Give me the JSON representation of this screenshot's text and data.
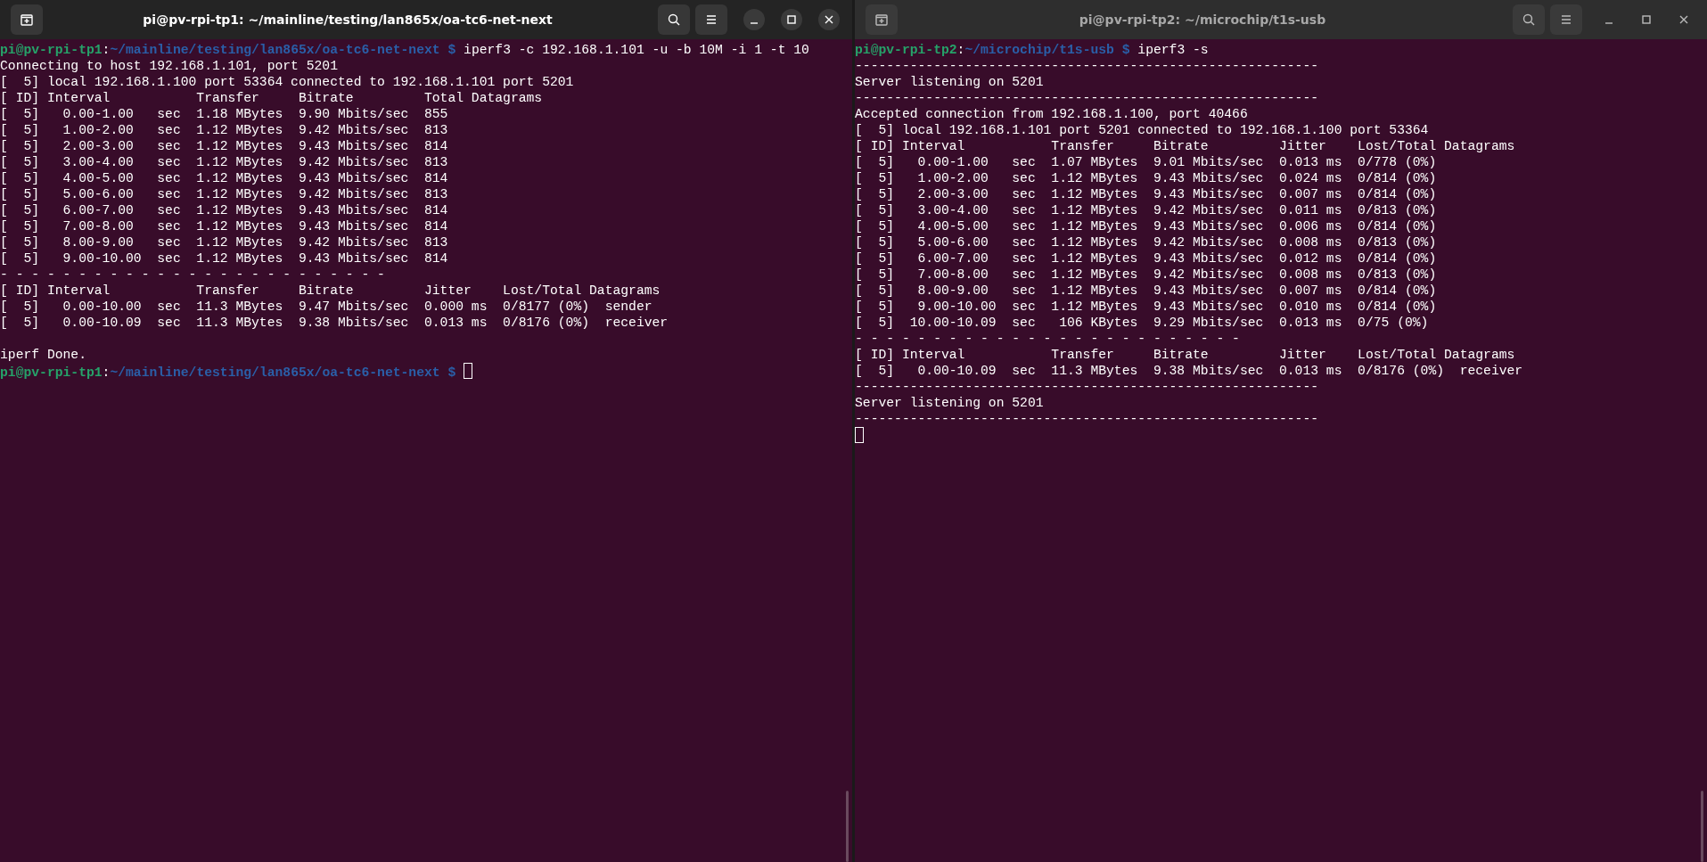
{
  "windows": [
    {
      "title": "pi@pv-rpi-tp1: ~/mainline/testing/lan865x/oa-tc6-net-next",
      "active": true,
      "lines": [
        {
          "kind": "prompt",
          "user_host": "pi@pv-rpi-tp1",
          "separator": ":",
          "path": "~/mainline/testing/lan865x/oa-tc6-net-next $",
          "command": "iperf3 -c 192.168.1.101 -u -b 10M -i 1 -t 10",
          "cursor": false
        },
        {
          "kind": "output",
          "text": "Connecting to host 192.168.1.101, port 5201"
        },
        {
          "kind": "output",
          "text": "[  5] local 192.168.1.100 port 53364 connected to 192.168.1.101 port 5201"
        },
        {
          "kind": "output",
          "text": "[ ID] Interval           Transfer     Bitrate         Total Datagrams"
        },
        {
          "kind": "output",
          "text": "[  5]   0.00-1.00   sec  1.18 MBytes  9.90 Mbits/sec  855"
        },
        {
          "kind": "output",
          "text": "[  5]   1.00-2.00   sec  1.12 MBytes  9.42 Mbits/sec  813"
        },
        {
          "kind": "output",
          "text": "[  5]   2.00-3.00   sec  1.12 MBytes  9.43 Mbits/sec  814"
        },
        {
          "kind": "output",
          "text": "[  5]   3.00-4.00   sec  1.12 MBytes  9.42 Mbits/sec  813"
        },
        {
          "kind": "output",
          "text": "[  5]   4.00-5.00   sec  1.12 MBytes  9.43 Mbits/sec  814"
        },
        {
          "kind": "output",
          "text": "[  5]   5.00-6.00   sec  1.12 MBytes  9.42 Mbits/sec  813"
        },
        {
          "kind": "output",
          "text": "[  5]   6.00-7.00   sec  1.12 MBytes  9.43 Mbits/sec  814"
        },
        {
          "kind": "output",
          "text": "[  5]   7.00-8.00   sec  1.12 MBytes  9.43 Mbits/sec  814"
        },
        {
          "kind": "output",
          "text": "[  5]   8.00-9.00   sec  1.12 MBytes  9.42 Mbits/sec  813"
        },
        {
          "kind": "output",
          "text": "[  5]   9.00-10.00  sec  1.12 MBytes  9.43 Mbits/sec  814"
        },
        {
          "kind": "output",
          "text": "- - - - - - - - - - - - - - - - - - - - - - - - -"
        },
        {
          "kind": "output",
          "text": "[ ID] Interval           Transfer     Bitrate         Jitter    Lost/Total Datagrams"
        },
        {
          "kind": "output",
          "text": "[  5]   0.00-10.00  sec  11.3 MBytes  9.47 Mbits/sec  0.000 ms  0/8177 (0%)  sender"
        },
        {
          "kind": "output",
          "text": "[  5]   0.00-10.09  sec  11.3 MBytes  9.38 Mbits/sec  0.013 ms  0/8176 (0%)  receiver"
        },
        {
          "kind": "blank"
        },
        {
          "kind": "output",
          "text": "iperf Done."
        },
        {
          "kind": "prompt",
          "user_host": "pi@pv-rpi-tp1",
          "separator": ":",
          "path": "~/mainline/testing/lan865x/oa-tc6-net-next $",
          "cursor": true
        }
      ]
    },
    {
      "title": "pi@pv-rpi-tp2: ~/microchip/t1s-usb",
      "active": false,
      "lines": [
        {
          "kind": "prompt",
          "user_host": "pi@pv-rpi-tp2",
          "separator": ":",
          "path": "~/microchip/t1s-usb $",
          "command": "iperf3 -s",
          "cursor": false
        },
        {
          "kind": "output",
          "text": "-----------------------------------------------------------"
        },
        {
          "kind": "output",
          "text": "Server listening on 5201"
        },
        {
          "kind": "output",
          "text": "-----------------------------------------------------------"
        },
        {
          "kind": "output",
          "text": "Accepted connection from 192.168.1.100, port 40466"
        },
        {
          "kind": "output",
          "text": "[  5] local 192.168.1.101 port 5201 connected to 192.168.1.100 port 53364"
        },
        {
          "kind": "output",
          "text": "[ ID] Interval           Transfer     Bitrate         Jitter    Lost/Total Datagrams"
        },
        {
          "kind": "output",
          "text": "[  5]   0.00-1.00   sec  1.07 MBytes  9.01 Mbits/sec  0.013 ms  0/778 (0%)"
        },
        {
          "kind": "output",
          "text": "[  5]   1.00-2.00   sec  1.12 MBytes  9.43 Mbits/sec  0.024 ms  0/814 (0%)"
        },
        {
          "kind": "output",
          "text": "[  5]   2.00-3.00   sec  1.12 MBytes  9.43 Mbits/sec  0.007 ms  0/814 (0%)"
        },
        {
          "kind": "output",
          "text": "[  5]   3.00-4.00   sec  1.12 MBytes  9.42 Mbits/sec  0.011 ms  0/813 (0%)"
        },
        {
          "kind": "output",
          "text": "[  5]   4.00-5.00   sec  1.12 MBytes  9.43 Mbits/sec  0.006 ms  0/814 (0%)"
        },
        {
          "kind": "output",
          "text": "[  5]   5.00-6.00   sec  1.12 MBytes  9.42 Mbits/sec  0.008 ms  0/813 (0%)"
        },
        {
          "kind": "output",
          "text": "[  5]   6.00-7.00   sec  1.12 MBytes  9.43 Mbits/sec  0.012 ms  0/814 (0%)"
        },
        {
          "kind": "output",
          "text": "[  5]   7.00-8.00   sec  1.12 MBytes  9.42 Mbits/sec  0.008 ms  0/813 (0%)"
        },
        {
          "kind": "output",
          "text": "[  5]   8.00-9.00   sec  1.12 MBytes  9.43 Mbits/sec  0.007 ms  0/814 (0%)"
        },
        {
          "kind": "output",
          "text": "[  5]   9.00-10.00  sec  1.12 MBytes  9.43 Mbits/sec  0.010 ms  0/814 (0%)"
        },
        {
          "kind": "output",
          "text": "[  5]  10.00-10.09  sec   106 KBytes  9.29 Mbits/sec  0.013 ms  0/75 (0%)"
        },
        {
          "kind": "output",
          "text": "- - - - - - - - - - - - - - - - - - - - - - - - -"
        },
        {
          "kind": "output",
          "text": "[ ID] Interval           Transfer     Bitrate         Jitter    Lost/Total Datagrams"
        },
        {
          "kind": "output",
          "text": "[  5]   0.00-10.09  sec  11.3 MBytes  9.38 Mbits/sec  0.013 ms  0/8176 (0%)  receiver"
        },
        {
          "kind": "output",
          "text": "-----------------------------------------------------------"
        },
        {
          "kind": "output",
          "text": "Server listening on 5201"
        },
        {
          "kind": "output",
          "text": "-----------------------------------------------------------"
        },
        {
          "kind": "cursor"
        }
      ]
    }
  ]
}
